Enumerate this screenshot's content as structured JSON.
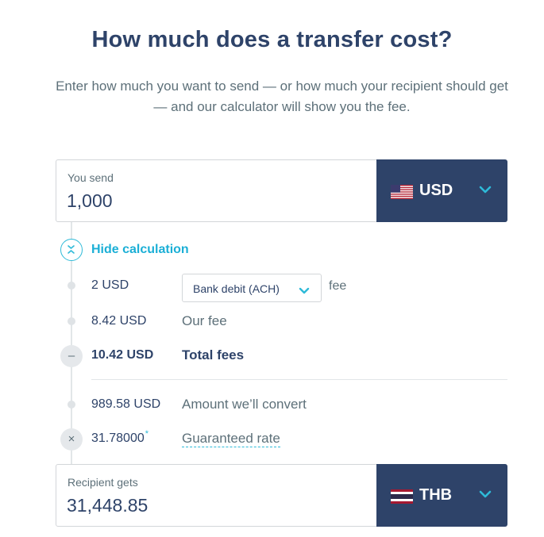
{
  "header": {
    "title": "How much does a transfer cost?",
    "subtitle": "Enter how much you want to send — or how much your recipient should get — and our calculator will show you the fee."
  },
  "send": {
    "label": "You send",
    "amount": "1,000",
    "currency": "USD",
    "flag_icon": "us-flag-icon"
  },
  "calculation": {
    "toggle_label": "Hide calculation",
    "payment_fee_amount": "2 USD",
    "payment_method": "Bank debit (ACH)",
    "payment_fee_suffix": "fee",
    "our_fee_amount": "8.42 USD",
    "our_fee_label": "Our fee",
    "total_fees_amount": "10.42 USD",
    "total_fees_label": "Total fees",
    "minus_symbol": "–",
    "convert_amount": "989.58 USD",
    "convert_label": "Amount we’ll convert",
    "multiply_symbol": "×",
    "rate_value": "31.78000",
    "rate_asterisk": "*",
    "rate_label": "Guaranteed rate"
  },
  "receive": {
    "label": "Recipient gets",
    "amount": "31,448.85",
    "currency": "THB",
    "flag_icon": "thai-flag-icon"
  },
  "colors": {
    "primary_navy": "#2e4369",
    "accent_blue": "#2ebad8",
    "muted_text": "#5d7079"
  }
}
